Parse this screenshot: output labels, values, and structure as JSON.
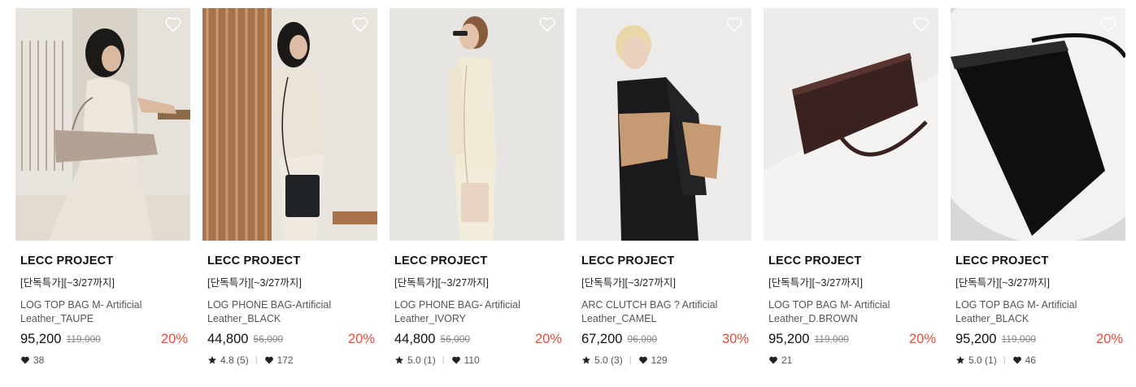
{
  "products": [
    {
      "brand": "LECC PROJECT",
      "promo": "[단독특가][~3/27까지]",
      "name_line1": "LOG TOP BAG M- Artificial",
      "name_line2": "Leather_TAUPE",
      "price": "95,200",
      "original_price": "119,000",
      "discount": "20%",
      "rating": "",
      "reviews": "",
      "likes": "38",
      "image_alt": "woman in beige outfit seated holding taupe shoulder bag"
    },
    {
      "brand": "LECC PROJECT",
      "promo": "[단독특가][~3/27까지]",
      "name_line1": "LOG PHONE BAG-Artificial",
      "name_line2": "Leather_BLACK",
      "price": "44,800",
      "original_price": "56,000",
      "discount": "20%",
      "rating": "4.8",
      "reviews": "(5)",
      "likes": "172",
      "image_alt": "woman in cream vest and pants with small black crossbody bag"
    },
    {
      "brand": "LECC PROJECT",
      "promo": "[단독특가][~3/27까지]",
      "name_line1": "LOG PHONE BAG- Artificial",
      "name_line2": "Leather_IVORY",
      "price": "44,800",
      "original_price": "56,000",
      "discount": "20%",
      "rating": "5.0",
      "reviews": "(1)",
      "likes": "110",
      "image_alt": "woman in ivory suit with sunglasses and ivory phone bag"
    },
    {
      "brand": "LECC PROJECT",
      "promo": "[단독특가][~3/27까지]",
      "name_line1": "ARC CLUTCH BAG ? Artificial",
      "name_line2": "Leather_CAMEL",
      "price": "67,200",
      "original_price": "96,000",
      "discount": "30%",
      "rating": "5.0",
      "reviews": "(3)",
      "likes": "129",
      "image_alt": "blonde woman in black suit holding camel clutch"
    },
    {
      "brand": "LECC PROJECT",
      "promo": "[단독특가][~3/27까지]",
      "name_line1": "LOG TOP BAG M- Artificial",
      "name_line2": "Leather_D.BROWN",
      "price": "95,200",
      "original_price": "119,000",
      "discount": "20%",
      "rating": "",
      "reviews": "",
      "likes": "21",
      "image_alt": "dark brown shoulder bag on white surface"
    },
    {
      "brand": "LECC PROJECT",
      "promo": "[단독특가][~3/27까지]",
      "name_line1": "LOG TOP BAG M- Artificial",
      "name_line2": "Leather_BLACK",
      "price": "95,200",
      "original_price": "119,000",
      "discount": "20%",
      "rating": "5.0",
      "reviews": "(1)",
      "likes": "46",
      "image_alt": "black shoulder bag on white surface"
    }
  ],
  "colors": {
    "discount": "#e74c3c",
    "text": "#111111",
    "muted": "#555555"
  },
  "icons": {
    "wishlist": "heart-outline-icon",
    "like": "heart-filled-icon",
    "rating": "star-icon"
  }
}
